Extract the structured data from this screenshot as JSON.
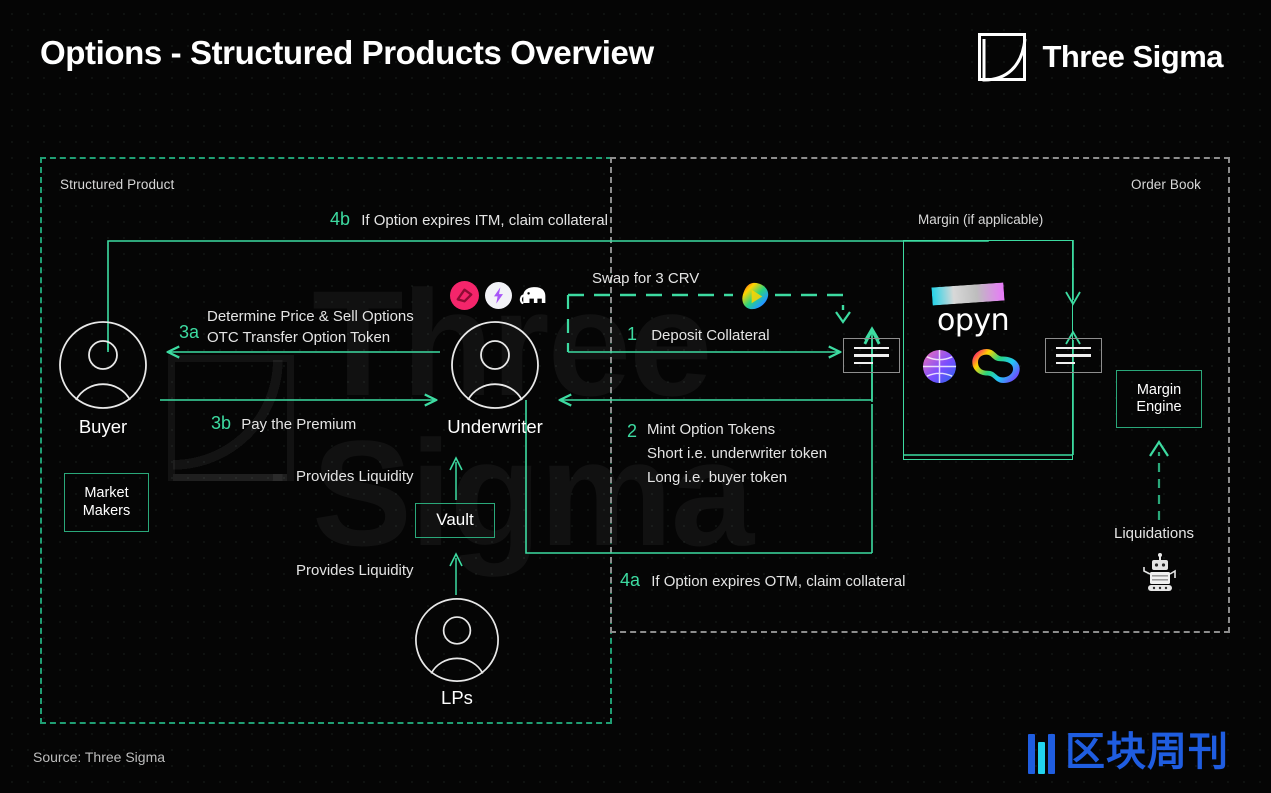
{
  "header": {
    "title": "Options - Structured Products Overview",
    "brand_name": "Three Sigma",
    "brand_mark": "three-sigma-square-curve-logo"
  },
  "regions": {
    "structured_product": {
      "label": "Structured Product",
      "border_color": "#1f9e73",
      "style": "dashed"
    },
    "order_book": {
      "label": "Order Book",
      "border_color": "#8d8d8d",
      "style": "dashed"
    },
    "margin": {
      "label": "Margin (if applicable)",
      "border_color": "#3ddba1",
      "style": "solid"
    }
  },
  "actors": {
    "buyer": "Buyer",
    "underwriter": "Underwriter",
    "lps": "LPs"
  },
  "boxes": {
    "market_makers": "Market\nMakers",
    "market_makers_line1": "Market",
    "market_makers_line2": "Makers",
    "vault": "Vault",
    "margin_engine_line1": "Margin",
    "margin_engine_line2": "Engine"
  },
  "flows": {
    "step4b_num": "4b",
    "step4b_text": "If Option expires ITM, claim collateral",
    "step3a_num": "3a",
    "step3a_line1": "Determine Price & Sell Options",
    "step3a_line2": "OTC Transfer Option Token",
    "step3b_num": "3b",
    "step3b_text": "Pay the Premium",
    "step1_num": "1",
    "step1_text": "Deposit Collateral",
    "step2_num": "2",
    "step2_line1": "Mint Option Tokens",
    "step2_line2": "Short i.e. underwriter token",
    "step2_line3": "Long i.e. buyer token",
    "step4a_num": "4a",
    "step4a_text": "If Option expires OTM, claim collateral",
    "swap_text": "Swap for  3 CRV",
    "provides_liquidity_1": "Provides Liquidity",
    "provides_liquidity_2": "Provides Liquidity",
    "liquidations": "Liquidations"
  },
  "protocol_icons": {
    "vault_group": [
      {
        "name": "ribbon-finance-icon",
        "colors": [
          "#ff3366",
          "#c4134a"
        ]
      },
      {
        "name": "thetanuts-lightning-icon",
        "colors": [
          "#ffffff",
          "#a855f7"
        ]
      },
      {
        "name": "mammoth-elephant-icon",
        "colors": [
          "#ffffff"
        ]
      }
    ],
    "swap_icon": {
      "name": "curve-finance-icon",
      "colors": [
        "#ff0000",
        "#ffff00",
        "#00ff88",
        "#0088ff"
      ]
    },
    "opyn": {
      "name": "opyn-logo",
      "label": "opyn",
      "banner_colors": [
        "#22d3ee",
        "#e879f9"
      ]
    },
    "exchange_group": [
      {
        "name": "gradient-sphere-icon",
        "colors": [
          "#f472b6",
          "#4f46e5"
        ]
      },
      {
        "name": "rainbow-peanut-icon",
        "colors": [
          "#ff0066",
          "#ffdd00",
          "#00ddaa",
          "#6600ff"
        ]
      }
    ],
    "document_left": "document-icon",
    "document_right": "document-icon",
    "liquidation_bot": "robot-icon"
  },
  "footer": {
    "source": "Source: Three Sigma",
    "publisher_text": "区块周刊",
    "publisher_mark": "blockweekly-bars-logo",
    "publisher_colors": [
      "#1f5de0",
      "#22d3ee"
    ]
  },
  "colors": {
    "background": "#050505",
    "accent_green": "#3ddba1",
    "region_green": "#1f9e73",
    "gray_border": "#8d8d8d",
    "text": "#ffffff"
  }
}
